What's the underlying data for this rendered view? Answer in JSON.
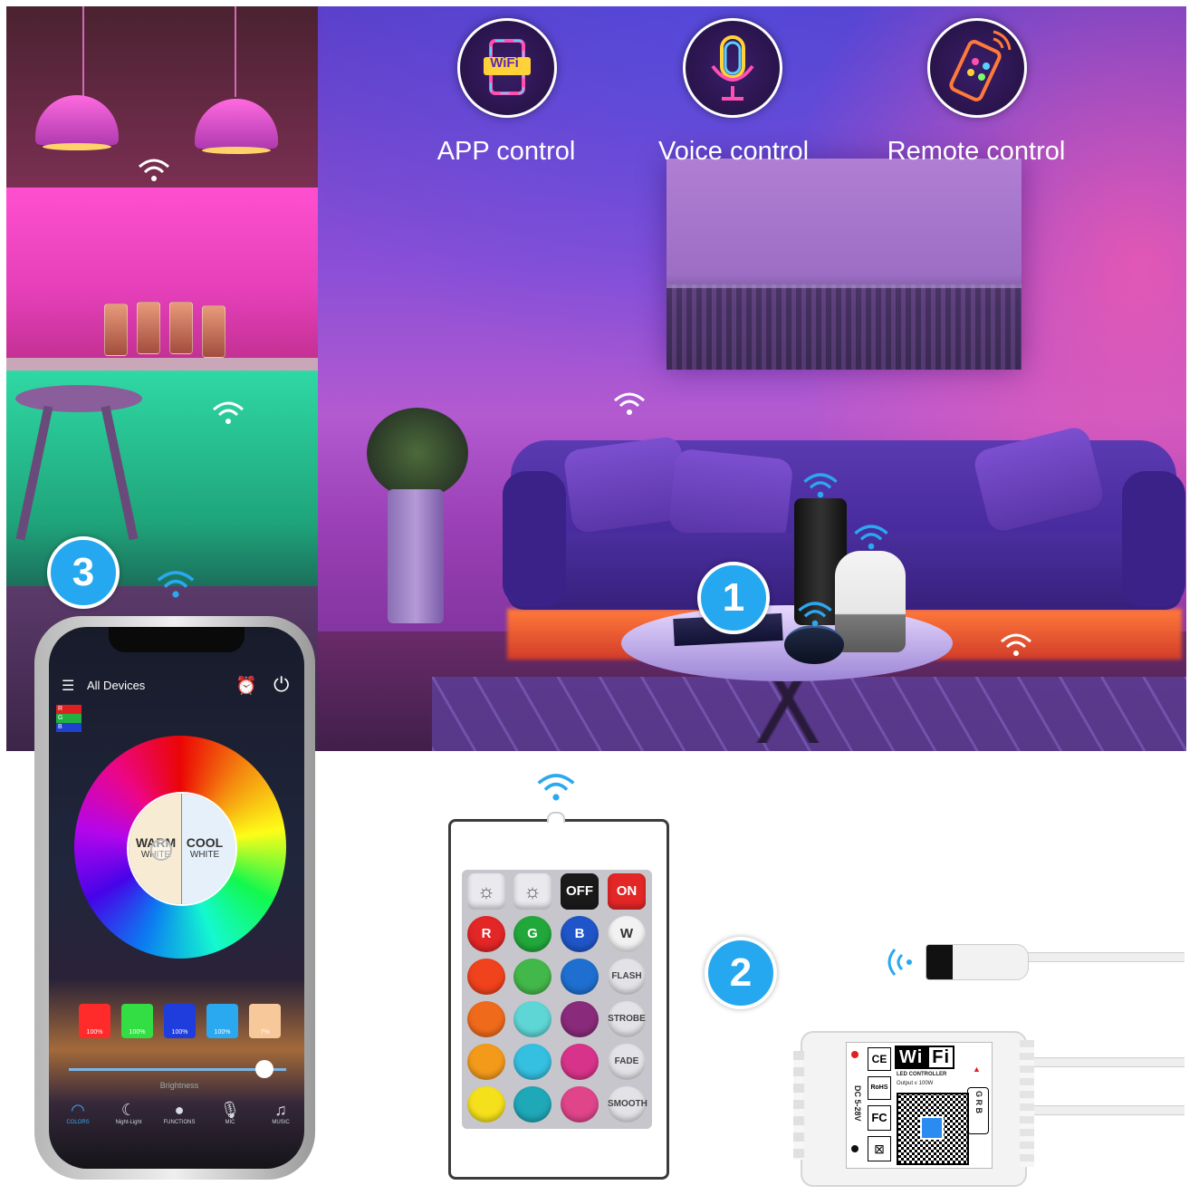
{
  "features": [
    {
      "icon": "wifi-phone-icon",
      "label": "APP control",
      "icon_text": "WiFi"
    },
    {
      "icon": "microphone-icon",
      "label": "Voice control"
    },
    {
      "icon": "remote-icon",
      "label": "Remote control"
    }
  ],
  "badges": {
    "one": "1",
    "two": "2",
    "three": "3"
  },
  "phone_app": {
    "header_title": "All Devices",
    "rgb_legend": [
      "R",
      "G",
      "B"
    ],
    "warm_label": "WARM",
    "warm_sub": "WHITE",
    "cool_label": "COOL",
    "cool_sub": "WHITE",
    "swatches": [
      {
        "color": "#ff2a2a",
        "percent": "100%"
      },
      {
        "color": "#33dd44",
        "percent": "100%"
      },
      {
        "color": "#1f3ddc",
        "percent": "100%"
      },
      {
        "color": "#2aa8f0",
        "percent": "100%"
      },
      {
        "color": "#f7c89a",
        "percent": "7%"
      }
    ],
    "brightness_label": "Brightness",
    "brightness_value": 0.9,
    "tabs": [
      {
        "icon": "colors-icon",
        "label": "COLORS",
        "active": true
      },
      {
        "icon": "moon-icon",
        "label": "Night-Light",
        "active": false
      },
      {
        "icon": "functions-icon",
        "label": "FUNCTIONS",
        "active": false
      },
      {
        "icon": "mic-icon",
        "label": "MIC",
        "active": false
      },
      {
        "icon": "music-note-icon",
        "label": "MUSIC",
        "active": false
      }
    ]
  },
  "remote": {
    "top_row": [
      {
        "label": "☼",
        "color": "#e9e9ee",
        "name": "brightness-down-button"
      },
      {
        "label": "☼",
        "color": "#e9e9ee",
        "name": "brightness-up-button"
      },
      {
        "label": "OFF",
        "color": "#1a1a1a",
        "name": "off-button"
      },
      {
        "label": "ON",
        "color": "#e32626",
        "name": "on-button"
      }
    ],
    "rgbw": [
      {
        "label": "R",
        "color": "#e32626"
      },
      {
        "label": "G",
        "color": "#22a83a"
      },
      {
        "label": "B",
        "color": "#1f55c8"
      },
      {
        "label": "W",
        "color": "#f2f2f2"
      }
    ],
    "color_rows": [
      [
        "#f0421c",
        "#43b84a",
        "#1f6fd0"
      ],
      [
        "#f06a1c",
        "#5fd6d6",
        "#8a2a7a"
      ],
      [
        "#f39a1a",
        "#35bfe0",
        "#d8338a"
      ],
      [
        "#f5e01c",
        "#1fa8b8",
        "#e0458a"
      ]
    ],
    "modes": [
      "FLASH",
      "STROBE",
      "FADE",
      "SMOOTH"
    ]
  },
  "controller": {
    "logo_left": "Wi",
    "logo_right": "Fi",
    "title": "LED CONTROLLER",
    "output": "Output ≤ 100W",
    "voltage": "DC 5-28V",
    "pins": "G R B",
    "marks": [
      "CE",
      "RoHS",
      "FC"
    ]
  }
}
